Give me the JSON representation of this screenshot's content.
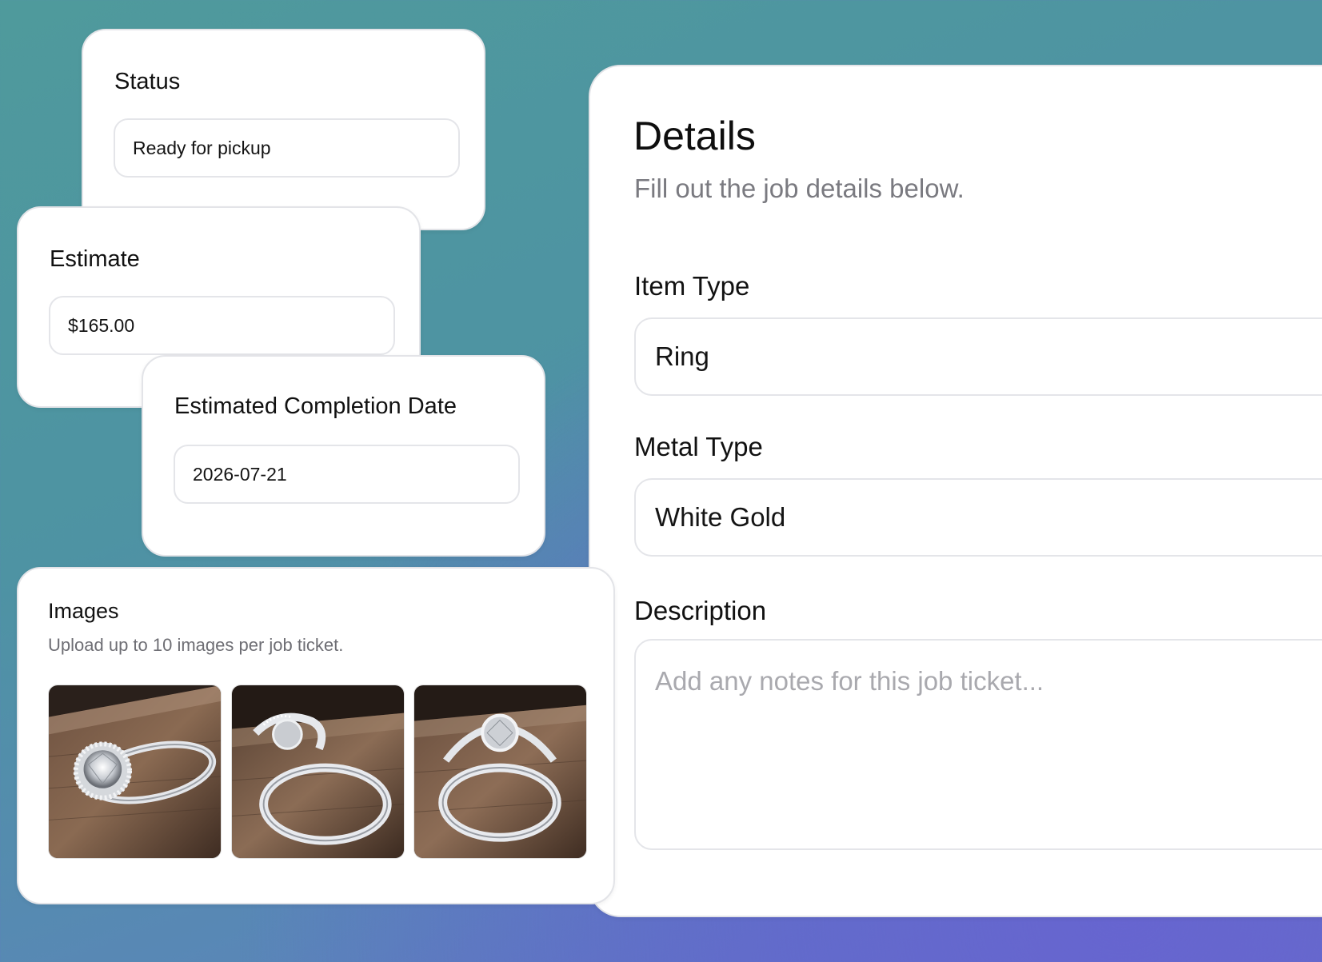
{
  "status": {
    "label": "Status",
    "value": "Ready for pickup"
  },
  "estimate": {
    "label": "Estimate",
    "value": "$165.00"
  },
  "completion": {
    "label": "Estimated Completion Date",
    "value": "2026-07-21"
  },
  "details": {
    "title": "Details",
    "subtitle": "Fill out the job details below.",
    "item_type": {
      "label": "Item Type",
      "value": "Ring"
    },
    "metal_type": {
      "label": "Metal Type",
      "value": "White Gold"
    },
    "description": {
      "label": "Description",
      "placeholder": "Add any notes for this job ticket..."
    }
  },
  "images": {
    "title": "Images",
    "subtitle": "Upload up to 10 images per job ticket.",
    "items": [
      {
        "alt": "ring-front-view"
      },
      {
        "alt": "ring-back-view"
      },
      {
        "alt": "ring-back-angle-view"
      }
    ]
  },
  "colors": {
    "card_border": "#e3e4e8",
    "muted_text": "#7a7a80",
    "placeholder_text": "#a9a9ae",
    "background_teal": "#4f9a9c",
    "background_violet": "#6470c4"
  }
}
